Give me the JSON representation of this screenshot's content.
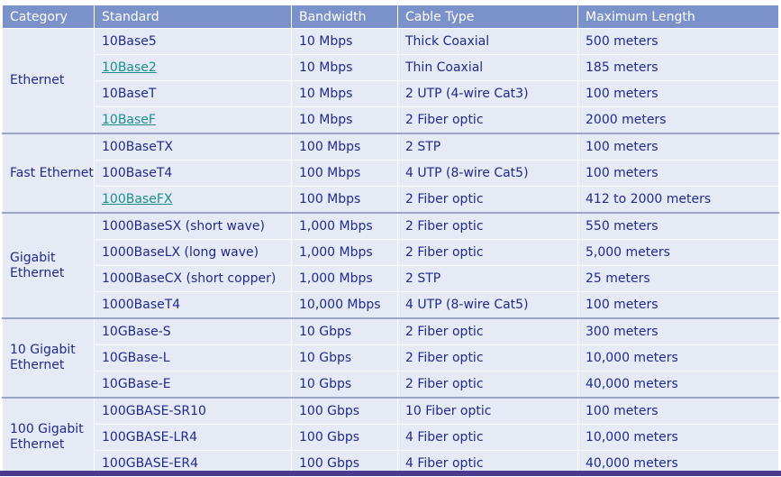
{
  "headers": [
    "Category",
    "Standard",
    "Bandwidth",
    "Cable Type",
    "Maximum Length"
  ],
  "groups": [
    {
      "category": "Ethernet",
      "rows": [
        {
          "standard": "10Base5",
          "link": false,
          "bandwidth": "10 Mbps",
          "cable": "Thick Coaxial",
          "length": "500 meters"
        },
        {
          "standard": "10Base2",
          "link": true,
          "bandwidth": "10 Mbps",
          "cable": "Thin Coaxial",
          "length": "185 meters"
        },
        {
          "standard": "10BaseT",
          "link": false,
          "bandwidth": "10 Mbps",
          "cable": "2 UTP (4-wire Cat3)",
          "length": "100 meters"
        },
        {
          "standard": "10BaseF",
          "link": true,
          "bandwidth": "10 Mbps",
          "cable": "2 Fiber optic",
          "length": "2000 meters"
        }
      ]
    },
    {
      "category": "Fast Ethernet",
      "rows": [
        {
          "standard": "100BaseTX",
          "link": false,
          "bandwidth": "100 Mbps",
          "cable": "2 STP",
          "length": "100 meters"
        },
        {
          "standard": "100BaseT4",
          "link": false,
          "bandwidth": "100 Mbps",
          "cable": "4 UTP (8-wire Cat5)",
          "length": "100 meters"
        },
        {
          "standard": "100BaseFX",
          "link": true,
          "bandwidth": "100 Mbps",
          "cable": "2 Fiber optic",
          "length": "412 to 2000 meters"
        }
      ]
    },
    {
      "category": "Gigabit Ethernet",
      "rows": [
        {
          "standard": "1000BaseSX (short wave)",
          "link": false,
          "bandwidth": "1,000 Mbps",
          "cable": "2 Fiber optic",
          "length": "550 meters"
        },
        {
          "standard": "1000BaseLX (long wave)",
          "link": false,
          "bandwidth": "1,000 Mbps",
          "cable": "2 Fiber optic",
          "length": "5,000 meters"
        },
        {
          "standard": "1000BaseCX (short copper)",
          "link": false,
          "bandwidth": "1,000 Mbps",
          "cable": "2 STP",
          "length": "25 meters"
        },
        {
          "standard": "1000BaseT4",
          "link": false,
          "bandwidth": "10,000 Mbps",
          "cable": "4 UTP (8-wire Cat5)",
          "length": "100 meters"
        }
      ]
    },
    {
      "category": "10 Gigabit Ethernet",
      "rows": [
        {
          "standard": "10GBase-S",
          "link": false,
          "bandwidth": "10 Gbps",
          "cable": "2 Fiber optic",
          "length": "300 meters"
        },
        {
          "standard": "10GBase-L",
          "link": false,
          "bandwidth": "10 Gbps",
          "cable": "2 Fiber optic",
          "length": "10,000 meters"
        },
        {
          "standard": "10GBase-E",
          "link": false,
          "bandwidth": "10 Gbps",
          "cable": "2 Fiber optic",
          "length": "40,000 meters"
        }
      ]
    },
    {
      "category": "100 Gigabit Ethernet",
      "rows": [
        {
          "standard": "100GBASE-SR10",
          "link": false,
          "bandwidth": "100 Gbps",
          "cable": "10 Fiber optic",
          "length": "100 meters"
        },
        {
          "standard": "100GBASE-LR4",
          "link": false,
          "bandwidth": "100 Gbps",
          "cable": "4 Fiber optic",
          "length": "10,000 meters"
        },
        {
          "standard": "100GBASE-ER4",
          "link": false,
          "bandwidth": "100 Gbps",
          "cable": "4 Fiber optic",
          "length": "40,000 meters"
        }
      ]
    }
  ],
  "colors": {
    "header_bg": "#7b91c9",
    "cell_bg": "#e6eaf5",
    "text": "#1f2a8c",
    "link": "#1a8f8f",
    "bottom_bar": "#4b3b8f"
  }
}
